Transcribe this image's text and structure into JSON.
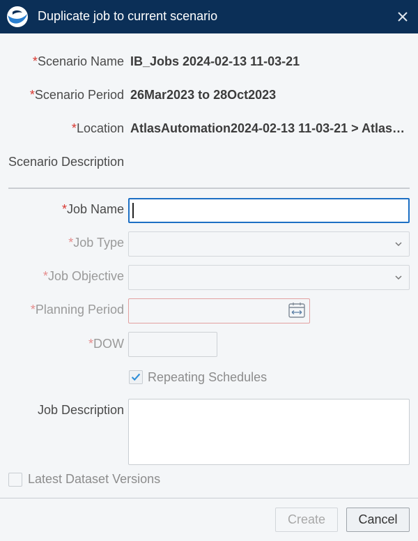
{
  "dialog": {
    "title": "Duplicate job to current scenario"
  },
  "scenario": {
    "name_label": "Scenario Name",
    "name_value": "IB_Jobs 2024-02-13 11-03-21",
    "period_label": "Scenario Period",
    "period_value": "26Mar2023 to 28Oct2023",
    "location_label": "Location",
    "location_value": "AtlasAutomation2024-02-13 11-03-21 > Atlas_...",
    "description_label": "Scenario Description"
  },
  "job": {
    "name_label": "Job Name",
    "name_value": "",
    "type_label": "Job Type",
    "type_value": "",
    "objective_label": "Job Objective",
    "objective_value": "",
    "planning_period_label": "Planning Period",
    "planning_period_value": "",
    "dow_label": "DOW",
    "dow_value": "",
    "repeating_label": "Repeating Schedules",
    "description_label": "Job Description",
    "description_value": ""
  },
  "latest_dataset": {
    "label": "Latest Dataset Versions"
  },
  "buttons": {
    "create": "Create",
    "cancel": "Cancel"
  },
  "colors": {
    "titlebar": "#0b2f57",
    "required": "#d8362f",
    "focus": "#1c6fc4"
  },
  "icons": [
    "app-logo-icon",
    "close-icon",
    "chevron-down-icon",
    "calendar-range-icon",
    "checkmark-icon"
  ]
}
